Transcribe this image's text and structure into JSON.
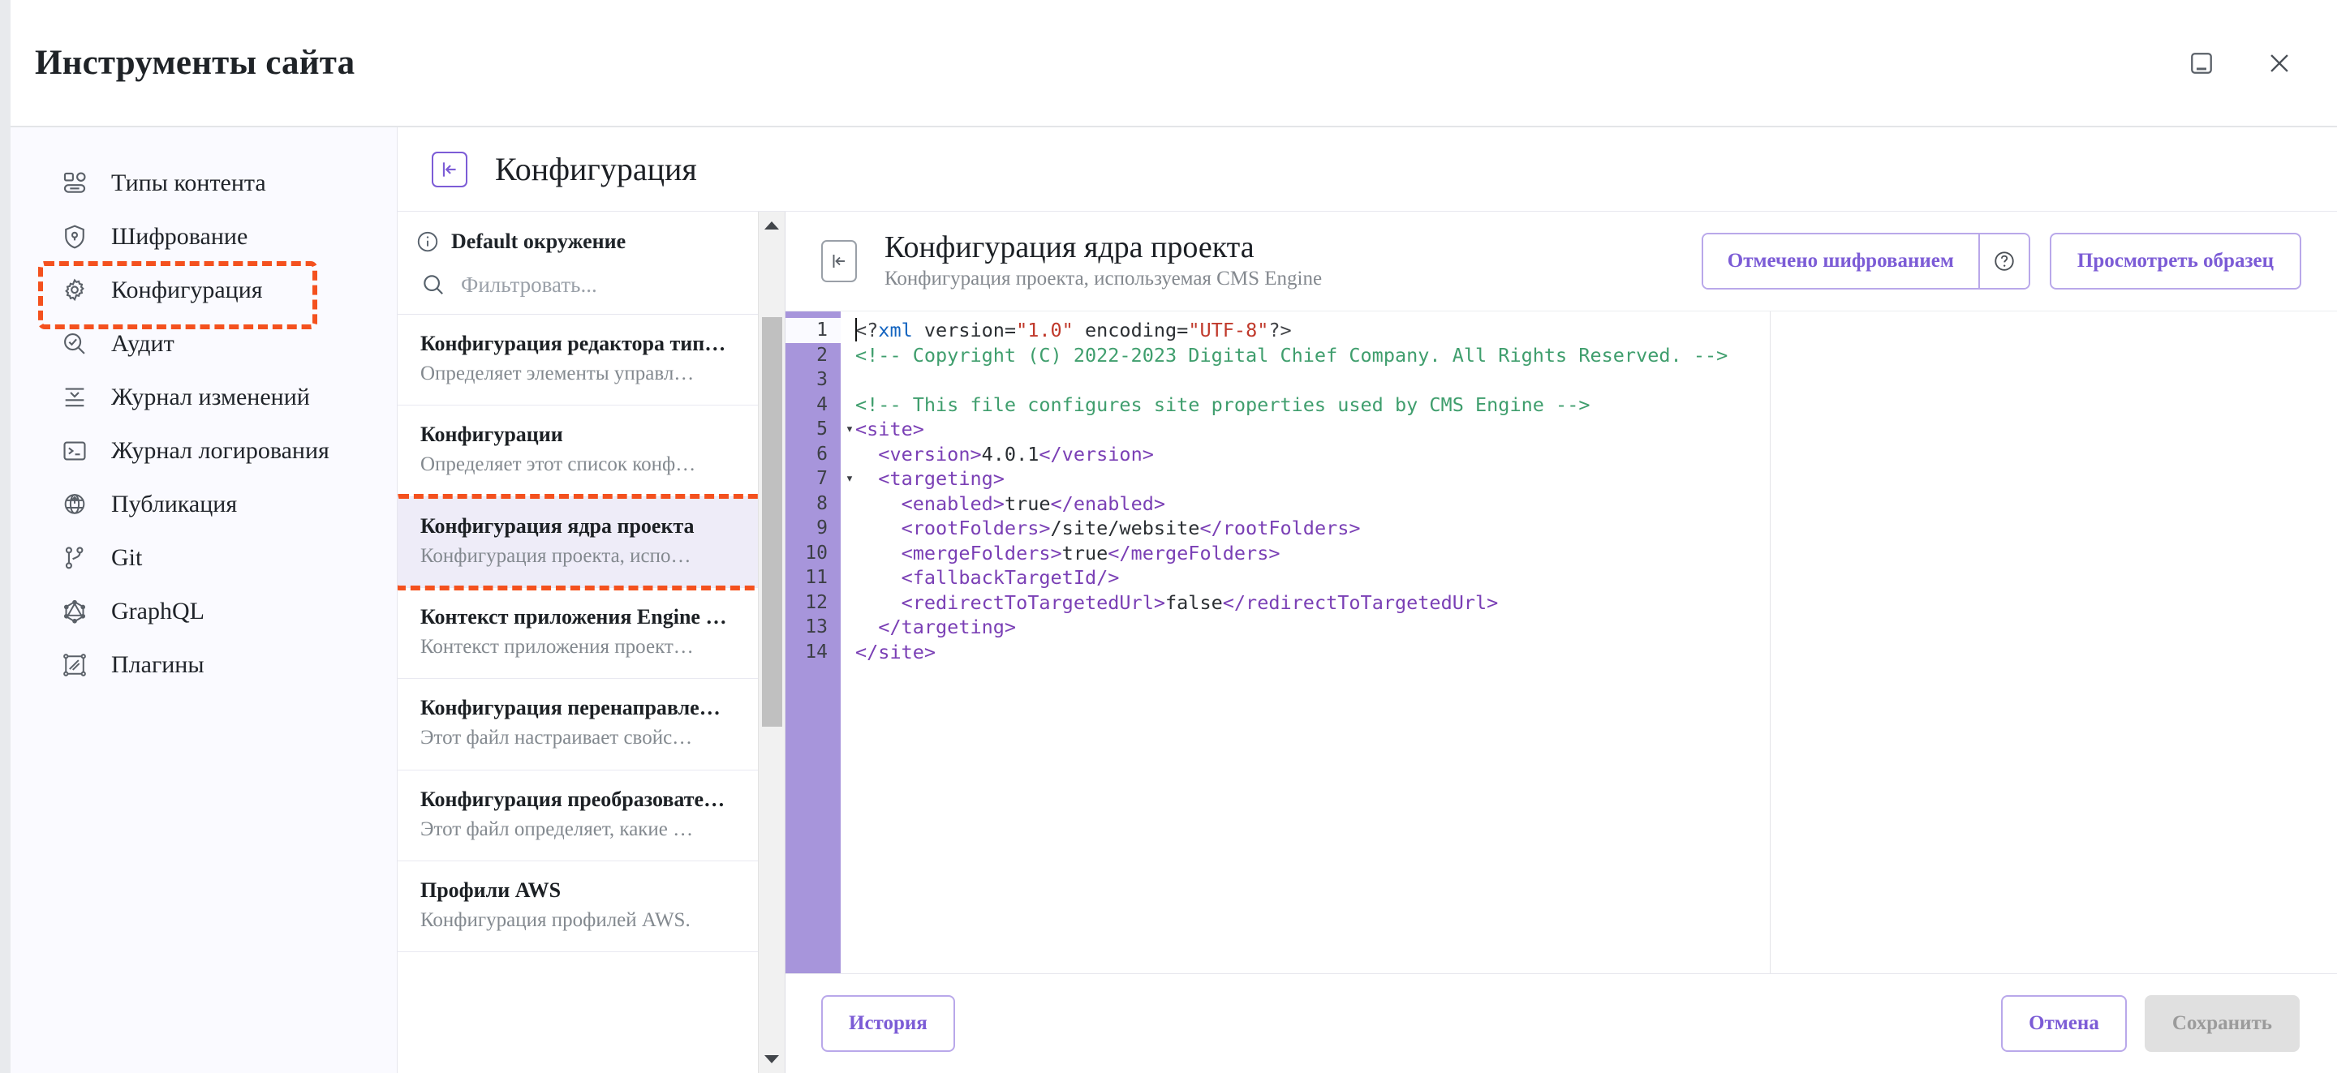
{
  "window": {
    "title": "Инструменты сайта",
    "minimize_icon": "dock-panel-icon",
    "close_icon": "close-icon"
  },
  "sidebar": {
    "items": [
      {
        "label": "Типы контента",
        "icon": "content-types-icon",
        "highlighted": false
      },
      {
        "label": "Шифрование",
        "icon": "shield-lock-icon",
        "highlighted": false
      },
      {
        "label": "Конфигурация",
        "icon": "gear-icon",
        "highlighted": true
      },
      {
        "label": "Аудит",
        "icon": "audit-search-icon",
        "highlighted": false
      },
      {
        "label": "Журнал изменений",
        "icon": "changelog-icon",
        "highlighted": false
      },
      {
        "label": "Журнал логирования",
        "icon": "terminal-icon",
        "highlighted": false
      },
      {
        "label": "Публикация",
        "icon": "globe-upload-icon",
        "highlighted": false
      },
      {
        "label": "Git",
        "icon": "git-branch-icon",
        "highlighted": false
      },
      {
        "label": "GraphQL",
        "icon": "graphql-icon",
        "highlighted": false
      },
      {
        "label": "Плагины",
        "icon": "plugins-icon",
        "highlighted": false
      }
    ]
  },
  "section": {
    "icon": "collapse-panel-icon",
    "title": "Конфигурация"
  },
  "list_panel": {
    "environment_icon": "info-icon",
    "environment_label": "Default окружение",
    "filter_icon": "search-icon",
    "filter_placeholder": "Фильтровать...",
    "filter_value": "",
    "items": [
      {
        "title": "Конфигурация редактора тип…",
        "desc": "Определяет элементы управл…",
        "selected": false,
        "highlighted": false
      },
      {
        "title": "Конфигурации",
        "desc": "Определяет этот список конф…",
        "selected": false,
        "highlighted": false
      },
      {
        "title": "Конфигурация ядра проекта",
        "desc": "Конфигурация проекта, испо…",
        "selected": true,
        "highlighted": true
      },
      {
        "title": "Контекст приложения Engine …",
        "desc": "Контекст приложения проект…",
        "selected": false,
        "highlighted": false
      },
      {
        "title": "Конфигурация перенаправле…",
        "desc": "Этот файл настраивает свойс…",
        "selected": false,
        "highlighted": false
      },
      {
        "title": "Конфигурация преобразовате…",
        "desc": "Этот файл определяет, какие …",
        "selected": false,
        "highlighted": false
      },
      {
        "title": "Профили AWS",
        "desc": "Конфигурация профилей AWS.",
        "selected": false,
        "highlighted": false
      }
    ],
    "scroll_up_icon": "chevron-up-icon",
    "scroll_down_icon": "chevron-down-icon"
  },
  "document": {
    "collapse_icon": "collapse-panel-icon",
    "title": "Конфигурация ядра проекта",
    "subtitle": "Конфигурация проекта, используемая CMS Engine",
    "encrypted_button": "Отмечено шифрованием",
    "help_icon": "question-circle-icon",
    "sample_button": "Просмотреть образец"
  },
  "editor": {
    "line_numbers": [
      1,
      2,
      3,
      4,
      5,
      6,
      7,
      8,
      9,
      10,
      11,
      12,
      13,
      14
    ],
    "fold_markers": {
      "5": "▾",
      "7": "▾"
    },
    "lines": [
      [
        {
          "t": "<?",
          "c": "punct"
        },
        {
          "t": "xml",
          "c": "pi"
        },
        {
          "t": " version=",
          "c": "text"
        },
        {
          "t": "\"1.0\"",
          "c": "str"
        },
        {
          "t": " encoding=",
          "c": "text"
        },
        {
          "t": "\"UTF-8\"",
          "c": "str"
        },
        {
          "t": "?>",
          "c": "punct"
        }
      ],
      [
        {
          "t": "<!-- Copyright (C) 2022-2023 Digital Chief Company. All Rights Reserved. -->",
          "c": "comment"
        }
      ],
      [],
      [
        {
          "t": "<!-- This file configures site properties used by CMS Engine -->",
          "c": "comment"
        }
      ],
      [
        {
          "t": "<site>",
          "c": "tag"
        }
      ],
      [
        {
          "t": "  <version>",
          "c": "tag"
        },
        {
          "t": "4.0.1",
          "c": "text"
        },
        {
          "t": "</version>",
          "c": "tag"
        }
      ],
      [
        {
          "t": "  <targeting>",
          "c": "tag"
        }
      ],
      [
        {
          "t": "    <enabled>",
          "c": "tag"
        },
        {
          "t": "true",
          "c": "text"
        },
        {
          "t": "</enabled>",
          "c": "tag"
        }
      ],
      [
        {
          "t": "    <rootFolders>",
          "c": "tag"
        },
        {
          "t": "/site/website",
          "c": "text"
        },
        {
          "t": "</rootFolders>",
          "c": "tag"
        }
      ],
      [
        {
          "t": "    <mergeFolders>",
          "c": "tag"
        },
        {
          "t": "true",
          "c": "text"
        },
        {
          "t": "</mergeFolders>",
          "c": "tag"
        }
      ],
      [
        {
          "t": "    <fallbackTargetId/>",
          "c": "tag"
        }
      ],
      [
        {
          "t": "    <redirectToTargetedUrl>",
          "c": "tag"
        },
        {
          "t": "false",
          "c": "text"
        },
        {
          "t": "</redirectToTargetedUrl>",
          "c": "tag"
        }
      ],
      [
        {
          "t": "  </targeting>",
          "c": "tag"
        }
      ],
      [
        {
          "t": "</site>",
          "c": "tag"
        }
      ]
    ],
    "raw_text": "<?xml version=\"1.0\" encoding=\"UTF-8\"?>\n<!-- Copyright (C) 2022-2023 Digital Chief Company. All Rights Reserved. -->\n\n<!-- This file configures site properties used by CMS Engine -->\n<site>\n  <version>4.0.1</version>\n  <targeting>\n    <enabled>true</enabled>\n    <rootFolders>/site/website</rootFolders>\n    <mergeFolders>true</mergeFolders>\n    <fallbackTargetId/>\n    <redirectToTargetedUrl>false</redirectToTargetedUrl>\n  </targeting>\n</site>"
  },
  "footer": {
    "history_button": "История",
    "cancel_button": "Отмена",
    "save_button": "Сохранить",
    "save_disabled": true
  },
  "colors": {
    "accent_purple": "#7c5cd6",
    "gutter_purple": "#a795db",
    "highlight_orange": "#f4511e",
    "selected_row": "#eeecf8",
    "page_background": "#e8eaed"
  }
}
